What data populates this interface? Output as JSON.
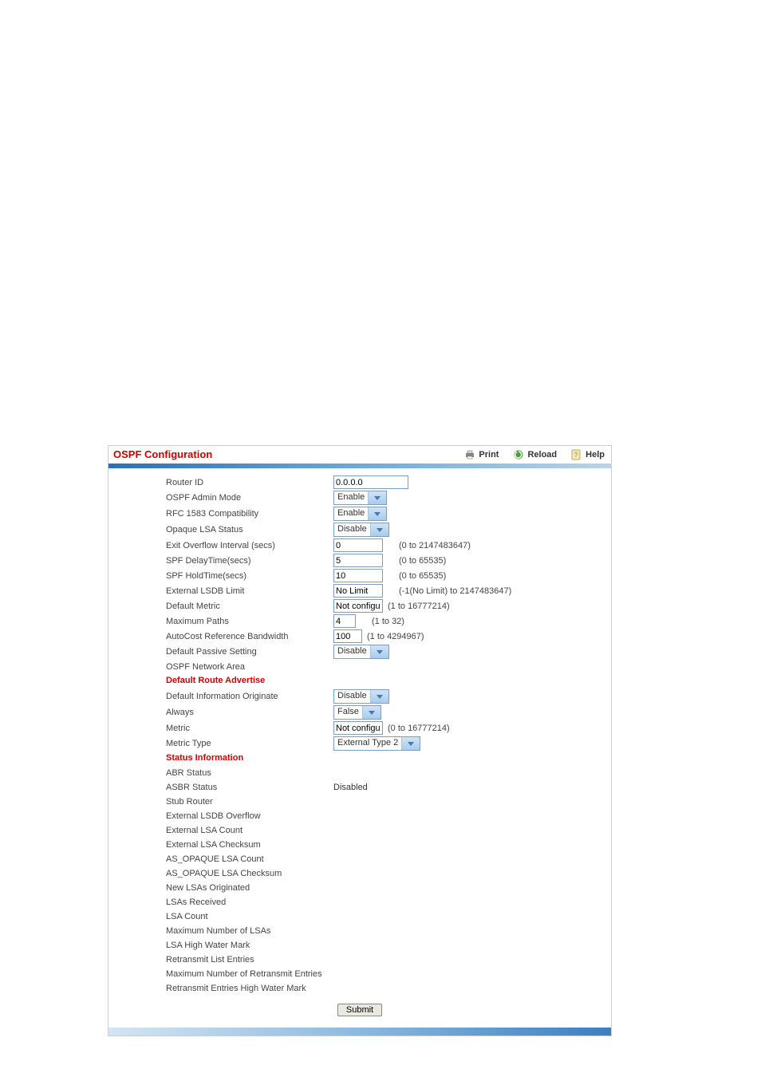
{
  "header": {
    "title": "OSPF Configuration",
    "print": "Print",
    "reload": "Reload",
    "help": "Help"
  },
  "fields": {
    "router_id": {
      "label": "Router ID",
      "value": "0.0.0.0"
    },
    "admin_mode": {
      "label": "OSPF Admin Mode",
      "value": "Enable"
    },
    "rfc1583": {
      "label": "RFC 1583 Compatibility",
      "value": "Enable"
    },
    "opaque_lsa": {
      "label": "Opaque LSA Status",
      "value": "Disable"
    },
    "exit_overflow": {
      "label": "Exit Overflow Interval (secs)",
      "value": "0",
      "hint": "(0 to 2147483647)"
    },
    "spf_delay": {
      "label": "SPF DelayTime(secs)",
      "value": "5",
      "hint": "(0 to 65535)"
    },
    "spf_hold": {
      "label": "SPF HoldTime(secs)",
      "value": "10",
      "hint": "(0 to 65535)"
    },
    "ext_lsdb_limit": {
      "label": "External LSDB Limit",
      "value": "No Limit",
      "hint": "(-1(No Limit) to 2147483647)"
    },
    "default_metric": {
      "label": "Default Metric",
      "value": "Not configu",
      "hint": "(1 to 16777214)"
    },
    "max_paths": {
      "label": "Maximum Paths",
      "value": "4",
      "hint": "(1 to 32)"
    },
    "autocost": {
      "label": "AutoCost Reference Bandwidth",
      "value": "100",
      "hint": "(1 to 4294967)"
    },
    "passive": {
      "label": "Default Passive Setting",
      "value": "Disable"
    },
    "network_area": {
      "label": "OSPF Network Area"
    }
  },
  "section_dra": "Default Route Advertise",
  "dra": {
    "dio": {
      "label": "Default Information Originate",
      "value": "Disable"
    },
    "always": {
      "label": "Always",
      "value": "False"
    },
    "metric": {
      "label": "Metric",
      "value": "Not configu",
      "hint": "(0 to 16777214)"
    },
    "metric_type": {
      "label": "Metric Type",
      "value": "External Type 2"
    }
  },
  "section_status": "Status Information",
  "status": {
    "abr": {
      "label": "ABR Status",
      "value": ""
    },
    "asbr": {
      "label": "ASBR Status",
      "value": "Disabled"
    },
    "stub": {
      "label": "Stub Router",
      "value": ""
    },
    "elo": {
      "label": "External LSDB Overflow",
      "value": ""
    },
    "elc": {
      "label": "External LSA Count",
      "value": ""
    },
    "elck": {
      "label": "External LSA Checksum",
      "value": ""
    },
    "aoc": {
      "label": "AS_OPAQUE LSA Count",
      "value": ""
    },
    "aock": {
      "label": "AS_OPAQUE LSA Checksum",
      "value": ""
    },
    "nlo": {
      "label": "New LSAs Originated",
      "value": ""
    },
    "lsar": {
      "label": "LSAs Received",
      "value": ""
    },
    "lsac": {
      "label": "LSA Count",
      "value": ""
    },
    "maxl": {
      "label": "Maximum Number of LSAs",
      "value": ""
    },
    "lhwm": {
      "label": "LSA High Water Mark",
      "value": ""
    },
    "rle": {
      "label": "Retransmit List Entries",
      "value": ""
    },
    "mre": {
      "label": "Maximum Number of Retransmit Entries",
      "value": ""
    },
    "rhwm": {
      "label": "Retransmit Entries High Water Mark",
      "value": ""
    }
  },
  "submit": "Submit"
}
